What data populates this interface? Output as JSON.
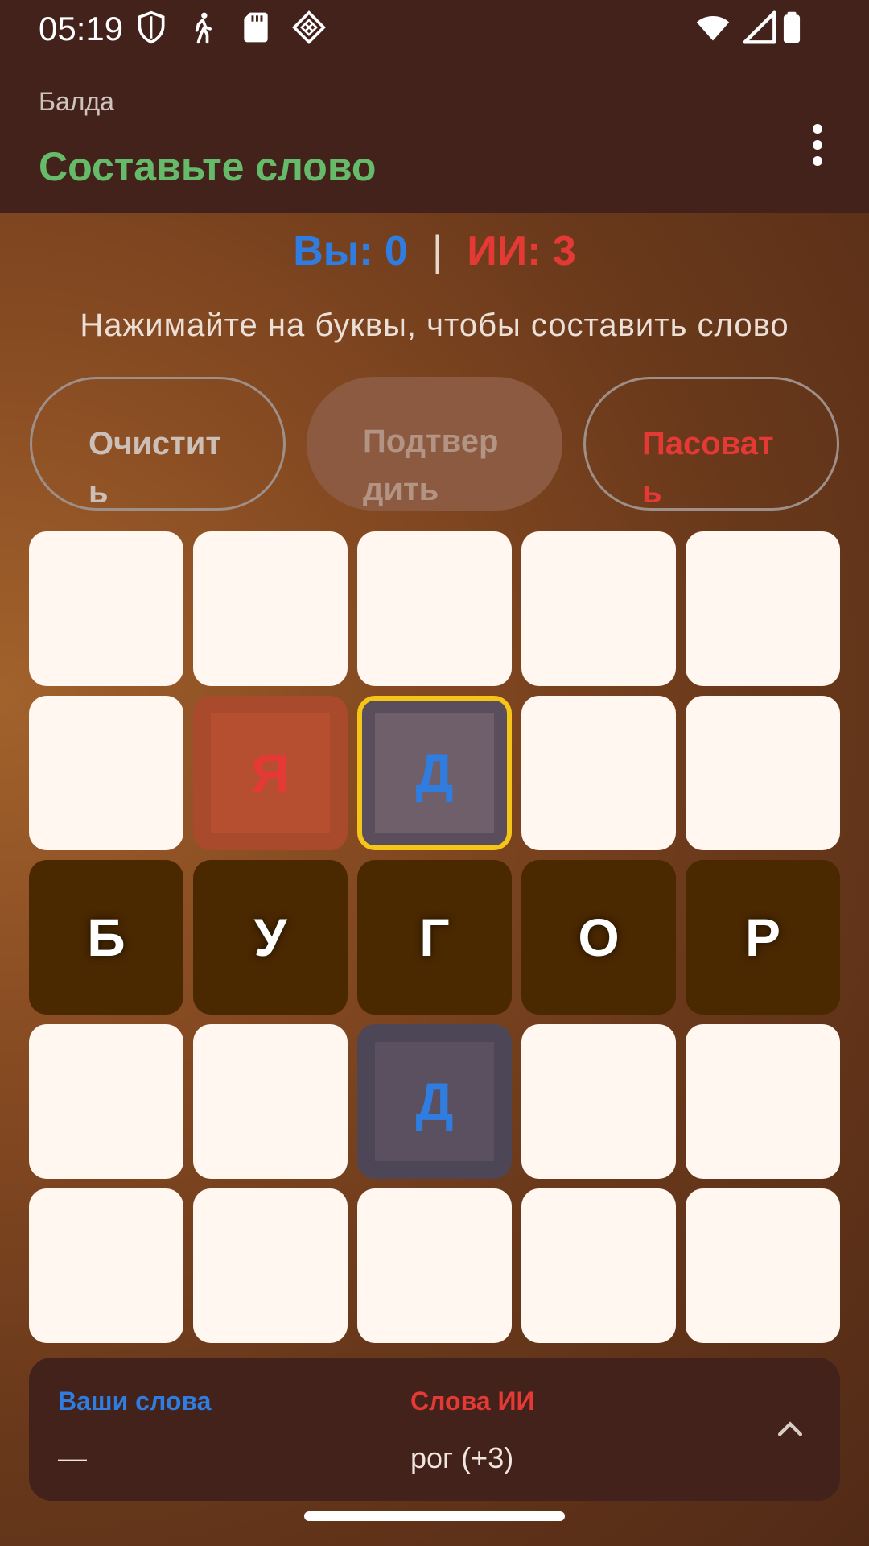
{
  "status_bar": {
    "time": "05:19",
    "left_icons": [
      "shield-icon",
      "walking-person-icon",
      "sd-card-icon",
      "diamond-app-icon"
    ],
    "right_icons": [
      "wifi-icon",
      "signal-icon",
      "battery-icon"
    ]
  },
  "app_bar": {
    "subtitle": "Балда",
    "title": "Составьте слово",
    "menu_icon": "more-vert-icon"
  },
  "score": {
    "you": "Вы: 0",
    "separator": "|",
    "ai": "ИИ: 3"
  },
  "hint": "Нажимайте на буквы, чтобы составить слово",
  "actions": {
    "clear_label": "Очистить",
    "confirm_label": "Подтвердить",
    "pass_label": "Пасовать"
  },
  "board": {
    "rows": [
      [
        {
          "letter": "",
          "state": "empty"
        },
        {
          "letter": "",
          "state": "empty"
        },
        {
          "letter": "",
          "state": "empty"
        },
        {
          "letter": "",
          "state": "empty"
        },
        {
          "letter": "",
          "state": "empty"
        }
      ],
      [
        {
          "letter": "",
          "state": "empty"
        },
        {
          "letter": "Я",
          "state": "ai-new"
        },
        {
          "letter": "Д",
          "state": "you-selected-active"
        },
        {
          "letter": "",
          "state": "empty"
        },
        {
          "letter": "",
          "state": "empty"
        }
      ],
      [
        {
          "letter": "Б",
          "state": "placed"
        },
        {
          "letter": "У",
          "state": "placed"
        },
        {
          "letter": "Г",
          "state": "placed"
        },
        {
          "letter": "О",
          "state": "placed"
        },
        {
          "letter": "Р",
          "state": "placed"
        }
      ],
      [
        {
          "letter": "",
          "state": "empty"
        },
        {
          "letter": "",
          "state": "empty"
        },
        {
          "letter": "Д",
          "state": "you-new"
        },
        {
          "letter": "",
          "state": "empty"
        },
        {
          "letter": "",
          "state": "empty"
        }
      ],
      [
        {
          "letter": "",
          "state": "empty"
        },
        {
          "letter": "",
          "state": "empty"
        },
        {
          "letter": "",
          "state": "empty"
        },
        {
          "letter": "",
          "state": "empty"
        },
        {
          "letter": "",
          "state": "empty"
        }
      ]
    ]
  },
  "words_panel": {
    "you_title": "Ваши слова",
    "you_words": "—",
    "ai_title": "Слова ИИ",
    "ai_words": "рог (+3)",
    "expand_icon": "chevron-up-icon"
  },
  "colors": {
    "you": "#2f7de1",
    "ai": "#e53935",
    "title_green": "#66bb6a",
    "active_border": "#f5c518"
  }
}
